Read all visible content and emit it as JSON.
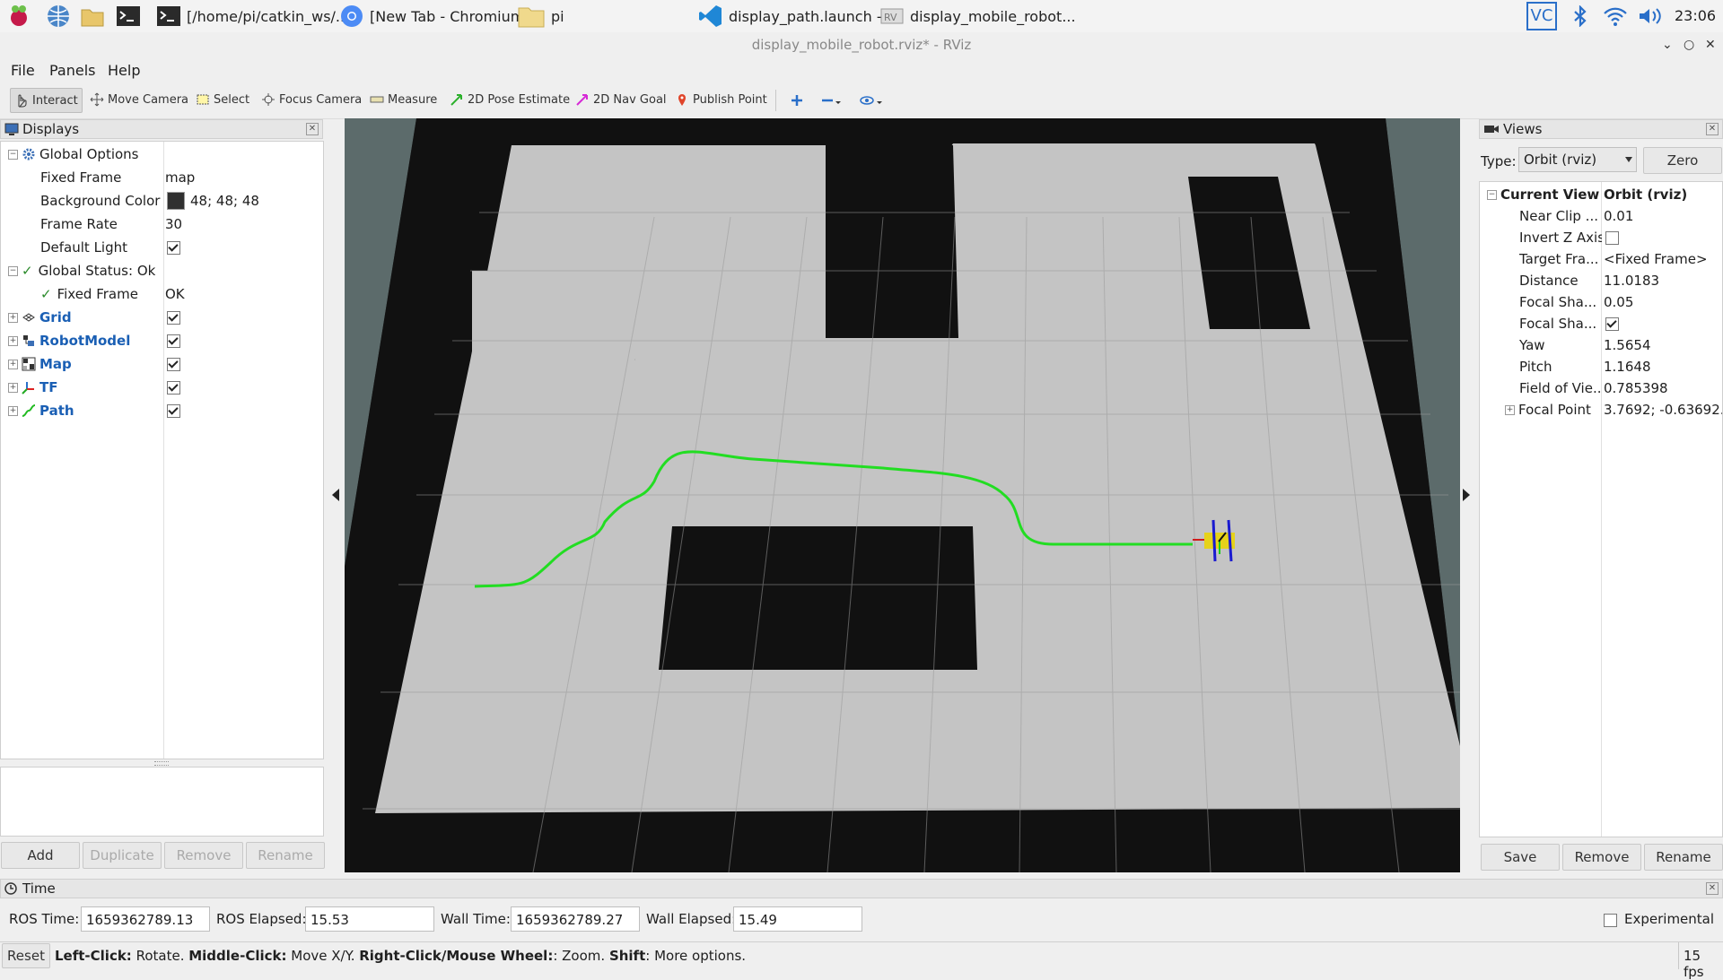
{
  "taskbar": {
    "tasks": [
      {
        "label": "[/home/pi/catkin_ws/...",
        "icon": "terminal-icon"
      },
      {
        "label": "[New Tab - Chromium]",
        "icon": "chromium-icon"
      },
      {
        "label": "pi",
        "icon": "folder-icon"
      },
      {
        "label": "display_path.launch -...",
        "icon": "vscode-icon"
      },
      {
        "label": "display_mobile_robot...",
        "icon": "rviz-icon"
      }
    ],
    "tray_text": "VC",
    "clock": "23:06"
  },
  "window": {
    "title": "display_mobile_robot.rviz* - RViz",
    "min": "⌄",
    "max": "○",
    "close": "✕"
  },
  "menu": {
    "file": "File",
    "panels": "Panels",
    "help": "Help"
  },
  "toolbar": {
    "interact": "Interact",
    "move_camera": "Move Camera",
    "select": "Select",
    "focus_camera": "Focus Camera",
    "measure": "Measure",
    "pose_estimate": "2D Pose Estimate",
    "nav_goal": "2D Nav Goal",
    "publish_point": "Publish Point"
  },
  "displays": {
    "title": "Displays",
    "global_options": "Global Options",
    "fixed_frame_label": "Fixed Frame",
    "fixed_frame_value": "map",
    "bg_color_label": "Background Color",
    "bg_color_value": "48; 48; 48",
    "bg_color_hex": "#303030",
    "frame_rate_label": "Frame Rate",
    "frame_rate_value": "30",
    "default_light_label": "Default Light",
    "global_status": "Global Status: Ok",
    "status_fixed_frame": "Fixed Frame",
    "status_fixed_frame_value": "OK",
    "items": [
      {
        "label": "Grid",
        "icon": "grid-icon"
      },
      {
        "label": "RobotModel",
        "icon": "robot-model-icon"
      },
      {
        "label": "Map",
        "icon": "map-icon"
      },
      {
        "label": "TF",
        "icon": "tf-icon"
      },
      {
        "label": "Path",
        "icon": "path-icon"
      }
    ],
    "buttons": {
      "add": "Add",
      "duplicate": "Duplicate",
      "remove": "Remove",
      "rename": "Rename"
    }
  },
  "views": {
    "title": "Views",
    "type_label": "Type:",
    "type_value": "Orbit (rviz)",
    "zero": "Zero",
    "current_view": "Current View",
    "current_view_value": "Orbit (rviz)",
    "props": [
      {
        "label": "Near Clip ...",
        "value": "0.01"
      },
      {
        "label": "Invert Z Axis",
        "value": ""
      },
      {
        "label": "Target Fra...",
        "value": "<Fixed Frame>"
      },
      {
        "label": "Distance",
        "value": "11.0183"
      },
      {
        "label": "Focal Sha...",
        "value": "0.05"
      },
      {
        "label": "Focal Sha...",
        "value": ""
      },
      {
        "label": "Yaw",
        "value": "1.5654"
      },
      {
        "label": "Pitch",
        "value": "1.1648"
      },
      {
        "label": "Field of Vie...",
        "value": "0.785398"
      },
      {
        "label": "Focal Point",
        "value": "3.7692; -0.63692..."
      }
    ],
    "buttons": {
      "save": "Save",
      "remove": "Remove",
      "rename": "Rename"
    }
  },
  "time": {
    "title": "Time",
    "ros_time_label": "ROS Time:",
    "ros_time": "1659362789.13",
    "ros_elapsed_label": "ROS Elapsed:",
    "ros_elapsed": "15.53",
    "wall_time_label": "Wall Time:",
    "wall_time": "1659362789.27",
    "wall_elapsed_label": "Wall Elapsed:",
    "wall_elapsed": "15.49",
    "experimental": "Experimental"
  },
  "status": {
    "reset": "Reset",
    "left_click": "Left-Click:",
    "rotate": " Rotate. ",
    "middle_click": "Middle-Click:",
    "move": " Move X/Y. ",
    "right_click": "Right-Click/Mouse Wheel:",
    "zoom": ": Zoom. ",
    "shift": "Shift",
    "more": ": More options.",
    "fps": "15 fps"
  },
  "colors": {
    "path": "#22dd22",
    "robot": "#e6d21a",
    "floor": "#c4c4c4",
    "obstacle": "#121212",
    "void": "#2c2c2c"
  }
}
